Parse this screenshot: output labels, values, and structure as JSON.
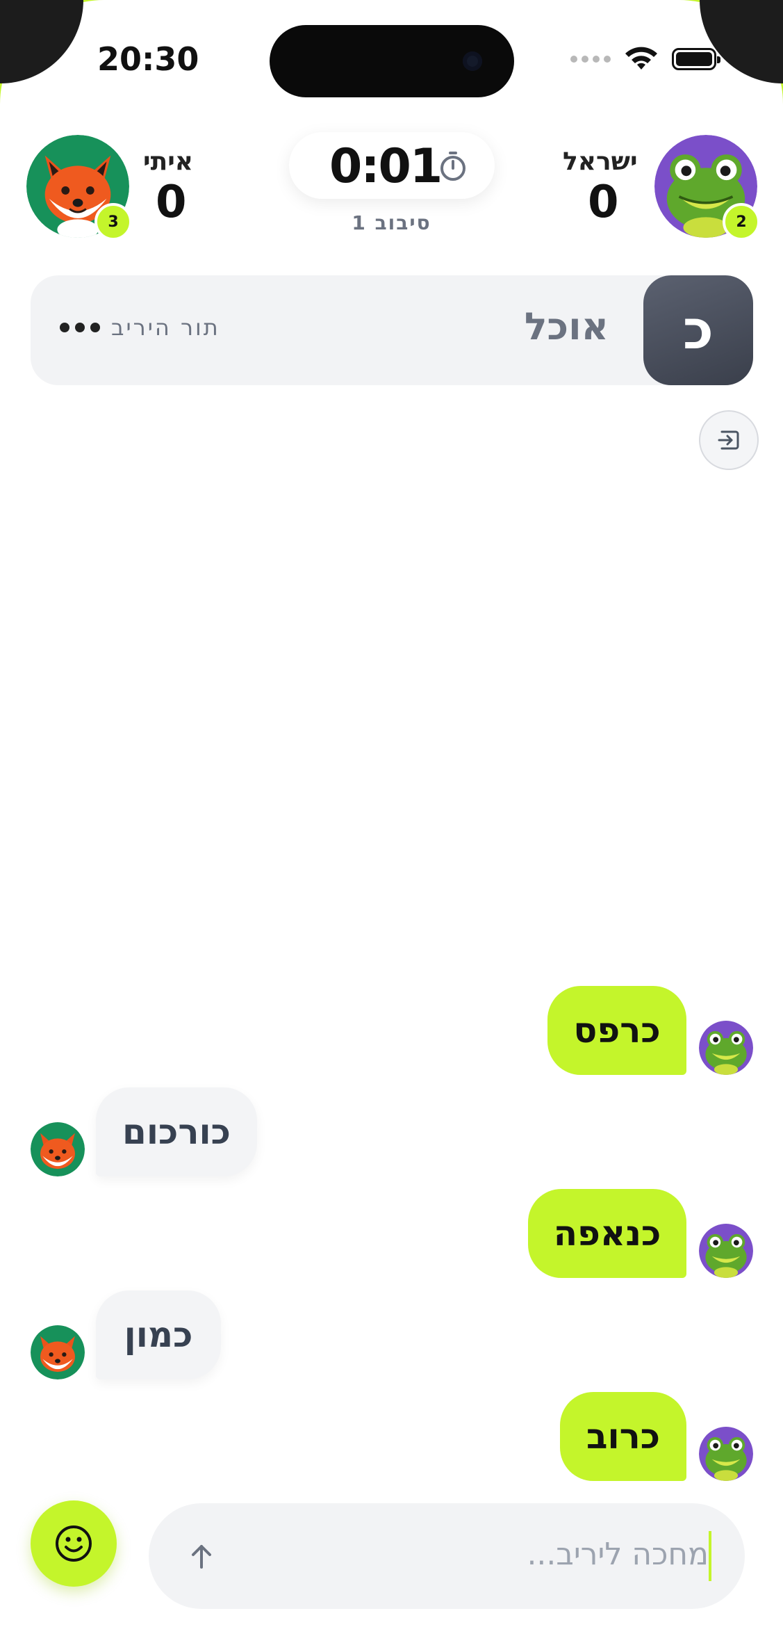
{
  "status_bar": {
    "time": "20:30"
  },
  "players": {
    "left": {
      "name": "איתי",
      "score": "0",
      "badge": "3",
      "avatar": "fox-avatar"
    },
    "right": {
      "name": "ישראל",
      "score": "0",
      "badge": "2",
      "avatar": "frog-avatar"
    }
  },
  "timer": {
    "value": "0:01",
    "round_label": "סיבוב 1"
  },
  "category": {
    "letter": "כ",
    "name": "אוכל",
    "turn_label": "תור היריב"
  },
  "messages": [
    {
      "sender": "me",
      "text": "כרפס"
    },
    {
      "sender": "opponent",
      "text": "כורכום"
    },
    {
      "sender": "me",
      "text": "כנאפה"
    },
    {
      "sender": "opponent",
      "text": "כמון"
    },
    {
      "sender": "me",
      "text": "כרוב"
    }
  ],
  "input": {
    "placeholder": "מחכה ליריב..."
  },
  "colors": {
    "accent": "#c4f52b",
    "opponent_bubble": "#f3f4f6",
    "tile": "#4a4f5c"
  },
  "icons": [
    "stopwatch-icon",
    "exit-icon",
    "smiley-icon",
    "arrow-up-icon"
  ]
}
